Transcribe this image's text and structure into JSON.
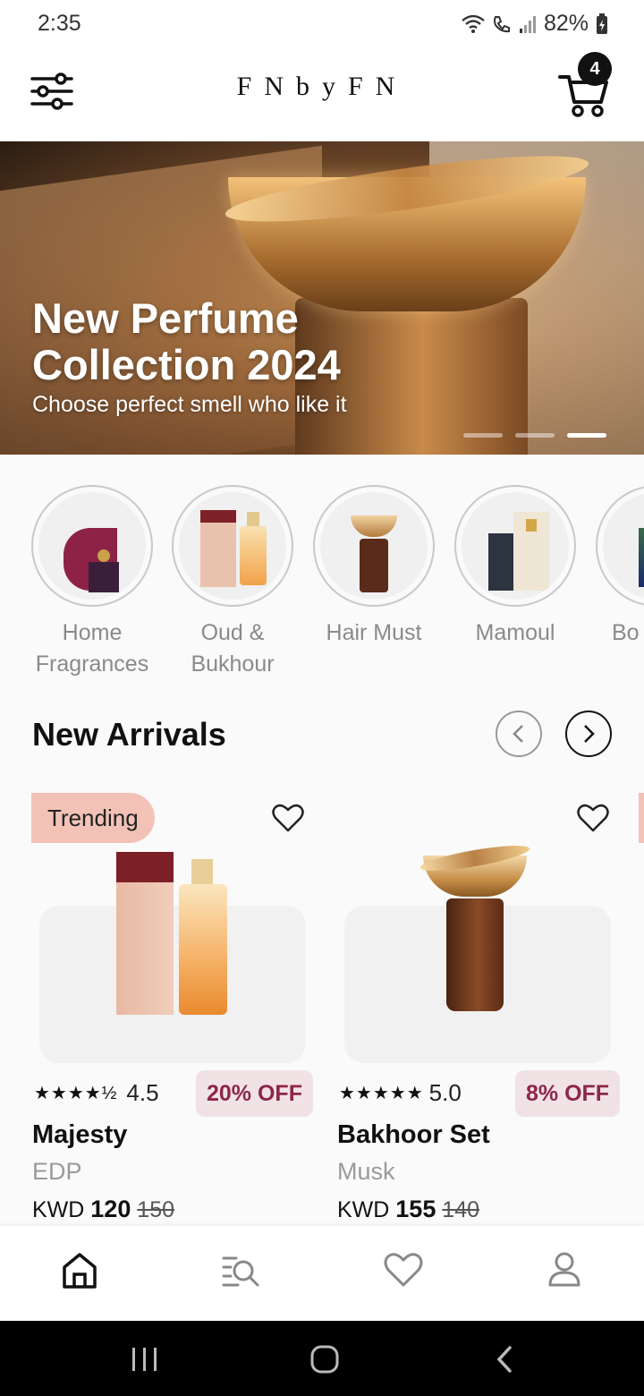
{
  "status": {
    "time": "2:35",
    "battery": "82%"
  },
  "header": {
    "logo": "FNbyFN",
    "cart_count": "4"
  },
  "banner": {
    "title": "New Perfume Collection 2024",
    "subtitle": "Choose perfect smell who like it",
    "slides": 3,
    "active_slide": 3
  },
  "categories": [
    {
      "label": "Home Fragrances"
    },
    {
      "label": "Oud & Bukhour"
    },
    {
      "label": "Hair Must"
    },
    {
      "label": "Mamoul"
    },
    {
      "label": "Bo"
    }
  ],
  "new_arrivals": {
    "title": "New Arrivals",
    "products": [
      {
        "badge": "Trending",
        "rating": "4.5",
        "stars": "★★★★½",
        "discount": "20% OFF",
        "name": "Majesty",
        "type": "EDP",
        "currency": "KWD",
        "price": "120",
        "old_price": "150"
      },
      {
        "badge": "",
        "rating": "5.0",
        "stars": "★★★★★",
        "discount": "8% OFF",
        "name": "Bakhoor Set",
        "type": "Musk",
        "currency": "KWD",
        "price": "155",
        "old_price": "140"
      }
    ]
  },
  "colors": {
    "accent": "#8c2748",
    "badge_bg": "#f3c2b7",
    "discount_bg": "#f1e2e6"
  },
  "bottom_nav": {
    "items": [
      "home-icon",
      "search-list-icon",
      "heart-icon",
      "user-icon"
    ]
  }
}
